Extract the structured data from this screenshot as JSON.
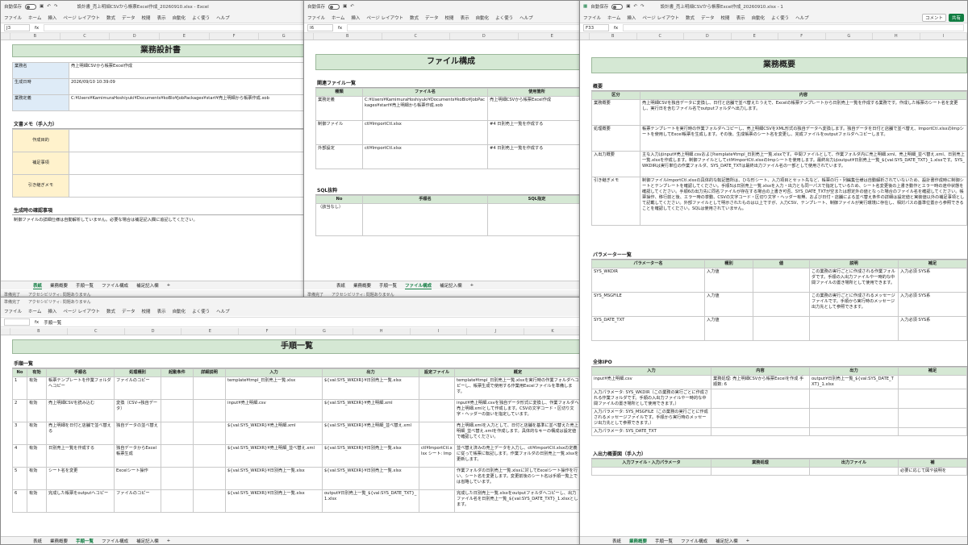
{
  "common": {
    "autosave": "自動保存",
    "formula_fx": "fx",
    "menu": [
      "ファイル",
      "ホーム",
      "挿入",
      "ページ レイアウト",
      "数式",
      "データ",
      "校閲",
      "表示",
      "自動化",
      "よく使う",
      "ヘルプ"
    ],
    "status_ready": "準備完了",
    "accessibility": "アクセシビリティ: 問題ありません"
  },
  "win_left": {
    "title": "設計書_売上明細CSVから帳票Excel作成_20260910.xlsx - Excel",
    "cellref": "J3",
    "cols": [
      "B",
      "C",
      "D",
      "E",
      "F",
      "G"
    ],
    "band": "業務設計書",
    "rows": [
      {
        "label": "業務名",
        "value": "売上明細CSVから帳票Excel作成"
      },
      {
        "label": "生成日時",
        "value": "2026/09/10 10:39:09"
      },
      {
        "label": "業務定義",
        "value": "C:¥Users¥KamimuraHoshiyuki¥Documents¥koBlo¥JobPackages¥start¥売上明細から帳票作成.xob"
      }
    ],
    "memo_title": "文書メモ（手入力）",
    "memo_rows": [
      "作成目的",
      "補足事項",
      "引き継ぎメモ"
    ],
    "confirm_title": "生成時の確認事項",
    "confirm_text": "制御ファイルの詳細仕様は自動解析していません。必要な場合は補足記入欄に追記してください。",
    "tabs": [
      "表紙",
      "業務概要",
      "手順一覧",
      "ファイル構成",
      "補足記入欄"
    ],
    "active_tab": "表紙"
  },
  "win_mid": {
    "cellref": "I6",
    "band": "ファイル構成",
    "section1": "関連ファイル一覧",
    "headers": [
      "種類",
      "ファイル名",
      "使用箇所"
    ],
    "files": [
      {
        "type": "業務定義",
        "name": "C:¥Users¥KamimuraHoshiyuki¥Documents¥koBlo¥JobPackages¥start¥売上明細から帳票作成.xob",
        "use": "売上明細CSVから帳票Excel作成"
      },
      {
        "type": "制御ファイル",
        "name": "ctl¥ImportCtl.xlsx",
        "use": "#4 日別売上一覧を作成する"
      },
      {
        "type": "外部設定",
        "name": "ctl¥ImportCtl.xlsx",
        "use": "#4 日別売上一覧を作成する"
      }
    ],
    "section2": "SQL抜粋",
    "sql_headers": [
      "No",
      "手順名",
      "SQL指定"
    ],
    "sql_empty": "（該当なし）",
    "tabs": [
      "表紙",
      "業務概要",
      "手順一覧",
      "ファイル構成",
      "補足記入欄"
    ],
    "active_tab": "ファイル構成"
  },
  "win_bottom": {
    "cellref": "",
    "formula": "手順一覧",
    "band": "手順一覧",
    "section": "手順一覧",
    "headers": [
      "No",
      "有効",
      "手順名",
      "処理種別",
      "起動条件",
      "詳細説明",
      "入力",
      "出力",
      "設定ファイル",
      "概定"
    ],
    "rows": [
      {
        "no": "1",
        "en": "有効",
        "name": "帳票テンプレートを作業フォルダへコピー",
        "kind": "ファイルのコピー",
        "in": "template¥tmpl_日別売上一覧.xlsx",
        "out": "${val:SYS_WKDIR}¥日別売上一覧.xlsx",
        "cfg": "",
        "note": "template¥tmpl_日別売上一覧.xlsxを実行時の作業フォルダへコピーし、帳票生成で使用する作業用Excelファイルを準備します。"
      },
      {
        "no": "2",
        "en": "有効",
        "name": "売上明細CSVを読み込む",
        "kind": "変換（CSV→独自データ）",
        "in": "input¥売上明細.csv",
        "out": "${val:SYS_WKDIR}¥売上明細.xml",
        "cfg": "",
        "note": "input¥売上明細.csvを独自データ形式に変換し、作業フォルダへ売上明細.xmlとして作成します。CSVの文字コード・区切り文字・ヘッダーの扱いを指定しています。"
      },
      {
        "no": "3",
        "en": "有効",
        "name": "売上明細を日付と店舗で並べ替える",
        "kind": "独自データの並べ替え",
        "in": "${val:SYS_WKDIR}¥売上明細.xml",
        "out": "${val:SYS_WKDIR}¥売上明細_並べ替え.xml",
        "cfg": "",
        "note": "売上明細.xmlを入力として、日付と店舗を基準に並べ替えた売上明細_並べ替え.xmlを作成します。具体的なキーの構成は設定値で確認してください。"
      },
      {
        "no": "4",
        "en": "有効",
        "name": "日別売上一覧を作成する",
        "kind": "独自データからExcel帳票生成",
        "in": "${val:SYS_WKDIR}¥売上明細_並べ替え.xml",
        "out": "${val:SYS_WKDIR}¥日別売上一覧.xlsx",
        "cfg": "ctl¥ImportCtl.xlsx シート: Imp",
        "note": "並べ替え済みの売上データを入力し、ctl¥ImportCtl.xlsxの定義に従って帳票に転記します。作業フォルダの日別売上一覧.xlsxを更新します。"
      },
      {
        "no": "5",
        "en": "有効",
        "name": "シート名を変更",
        "kind": "Excelシート操作",
        "in": "${val:SYS_WKDIR}¥日別売上一覧.xlsx",
        "out": "${val:SYS_WKDIR}¥日別売上一覧.xlsx",
        "cfg": "",
        "note": "作業フォルダの日別売上一覧.xlsxに対してExcelシート操作を行い、シート名を変更します。変更前後のシート名は手順一覧上では省略しています。"
      },
      {
        "no": "6",
        "en": "有効",
        "name": "完成した帳票をoutputへコピー",
        "kind": "ファイルのコピー",
        "in": "${val:SYS_WKDIR}¥日別売上一覧.xlsx",
        "out": "output¥日別売上一覧_${val:SYS_DATE_TXT}_1.xlsx",
        "cfg": "",
        "note": "完成した日別売上一覧.xlsxをoutputフォルダへコピーし、出力ファイル名を日別売上一覧_${val:SYS_DATE_TXT}_1.xlsxとします。"
      }
    ],
    "tabs": [
      "表紙",
      "業務概要",
      "手順一覧",
      "ファイル構成",
      "補足記入欄"
    ],
    "active_tab": "手順一覧"
  },
  "win_right": {
    "title": "設計書_売上明細CSVから帳票Excel作成_20260910.xlsx - 1",
    "cellref": "F33",
    "comment_btn": "コメント",
    "share_btn": "共有",
    "band": "業務概要",
    "overview_title": "概要",
    "overview_headers": [
      "区分",
      "内容"
    ],
    "overview": [
      {
        "k": "業務概要",
        "v": "売上明細CSVを独自データに変換し、日付と店舗で並べ替えたうえで、Excelの帳票テンプレートから日別売上一覧を作成する業務です。作成した帳票のシート名を変更し、実行日を含むファイル名でoutputフォルダへ出力します。"
      },
      {
        "k": "処理概要",
        "v": "帳票テンプレートを実行時の作業フォルダへコピーし、売上明細CSVをXML形式の独自データへ変換します。独自データを日付と店舗で並べ替え、ImportCtl.xlsxのImpシートを使用してExcel帳票を生成します。その後、生成帳票のシート名を変更し、完成ファイルをoutputフォルダへコピーします。"
      },
      {
        "k": "入出力概要",
        "v": "主な入力はinput¥売上明細.csvおよびtemplate¥tmpl_日別売上一覧.xlsxです。中間ファイルとして、作業フォルダ内に売上明細.xml、売上明細_並べ替え.xml、日別売上一覧.xlsxを作成します。制御ファイルとしてctl¥ImportCtl.xlsxのImpシートを使用します。最終出力はoutput¥日別売上一覧_${val:SYS_DATE_TXT}_1.xlsxです。SYS_WKDIRは実行単位の作業フォルダ、SYS_DATE_TXTは最終出力ファイル名の一部として使用されています。"
      },
      {
        "k": "引き継ぎメモ",
        "v": "制御ファイルImportCtl.xlsxの具体的な転記箇所は、ひな形シート、入力項目とセット先など、帳票の行・列編集仕様は自動解析されていないため、設計書作成時に制御シートとテンプレートを確認してください。手順5は日別売上一覧.xlsxを入力・出力とも同一パスで指定しているため、シート名変更後の上書き動作とエラー時の途中状態を確認してください。手順6の出力先に同名ファイルが存在する場合の上書き可否、SYS_DATE_TXTが空または想定外の値となった場合のファイル名を確認してください。帳票操作、移行前と後、エラー時の挙動、CSVの文字コード・区切り文字・ヘッダー有無、および日付・店舗による並べ替え条件の詳細は設定値と実装値以外の補足事項として記載してください。外部ファイルとして明示されたものは以上ですが、入力CSV、テンプレート、制御ファイルが実行環境に存在し、相対パスの基準位置から参照できることを確認してください。SQLは使用されていません。"
      }
    ],
    "param_title": "パラメーター一覧",
    "param_headers": [
      "パラメーター名",
      "種別",
      "値",
      "説明",
      "補足"
    ],
    "params": [
      {
        "n": "SYS_WKDIR",
        "t": "入力値",
        "v": "",
        "d": "この業務の実行ごとに作成される作業フォルダです。手順の入出力ファイルや一時的な中間ファイルの置き場所として使用できます。",
        "s": "入力必須 SYS系"
      },
      {
        "n": "SYS_MSGFILE",
        "t": "入力値",
        "v": "",
        "d": "この業務の実行ごとに作成されるメッセージファイルです。手順から実行時のメッセージ出力先として参照できます。",
        "s": "入力必須 SYS系"
      },
      {
        "n": "SYS_DATE_TXT",
        "t": "入力値",
        "v": "",
        "d": "",
        "s": "入力必須 SYS系"
      }
    ],
    "ipo_title": "全体IPO",
    "ipo_headers": [
      "入力",
      "内容",
      "出力",
      "補足"
    ],
    "ipo": [
      {
        "i": "input¥売上明細.csv",
        "c": "業務処理: 売上明細CSVから帳票Excelを作成 手順数: 6",
        "o": "output¥日別売上一覧_${val:SYS_DATE_TXT}_1.xlsx",
        "s": ""
      },
      {
        "i": "入力パラメータ: SYS_WKDIR（この業務の実行ごとに作成される作業フォルダです。手順の入出力ファイルや一時的な中間ファイルの置き場所として使用できます。）",
        "c": "",
        "o": "",
        "s": ""
      },
      {
        "i": "入力パラメータ: SYS_MSGFILE（この業務の実行ごとに作成されるメッセージファイルです。手順から実行時のメッセージ出力先として参照できます。）",
        "c": "",
        "o": "",
        "s": ""
      },
      {
        "i": "入力パラメータ: SYS_DATE_TXT",
        "c": "",
        "o": "",
        "s": ""
      }
    ],
    "io_title": "入出力概要図（手入力）",
    "io_headers": [
      "入力ファイル・入力パラメータ",
      "業務処理",
      "出力ファイル",
      "補"
    ],
    "io_note": "必要に応じて図や説明を",
    "tabs": [
      "表紙",
      "業務概要",
      "手順一覧",
      "ファイル構成",
      "補足記入欄"
    ],
    "active_tab": "業務概要"
  }
}
